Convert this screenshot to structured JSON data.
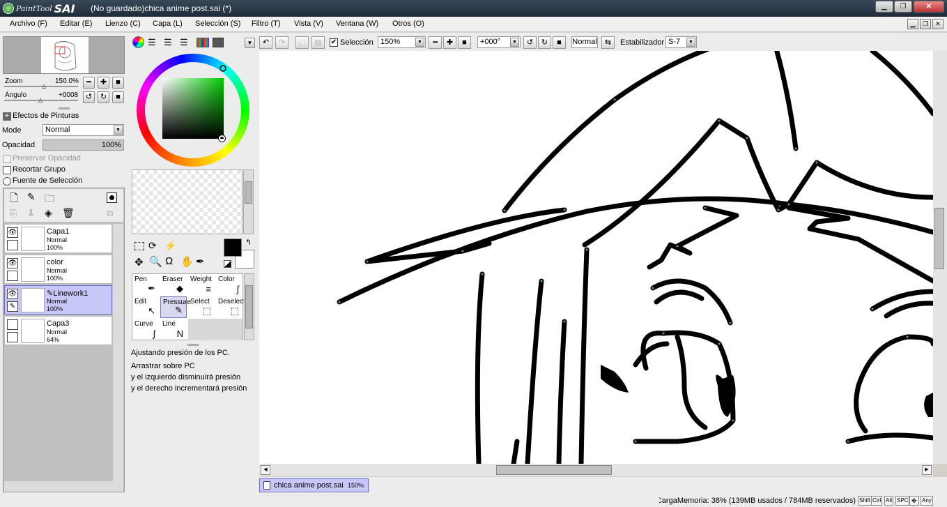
{
  "window": {
    "logo_text": "PaintTool",
    "logo_sai": "SAI",
    "title": "(No guardado)chica anime post.sai (*)"
  },
  "menu": [
    "Archivo (F)",
    "Editar (E)",
    "Lienzo (C)",
    "Capa (L)",
    "Selección (S)",
    "Filtro (T)",
    "Vista (V)",
    "Ventana (W)",
    "Otros (O)"
  ],
  "navigator": {
    "zoom_label": "Zoom",
    "zoom_value": "150.0%",
    "angle_label": "Ángulo",
    "angle_value": "+0008"
  },
  "layer_panel": {
    "effects_label": "Efectos de Pinturas",
    "mode_label": "Mode",
    "mode_value": "Normal",
    "opacity_label": "Opacidad",
    "opacity_value": "100%",
    "preserve_opacity": "Preservar Opacidad",
    "clip_group": "Recortar Grupo",
    "selection_source": "Fuente de Selección",
    "layers": [
      {
        "name": "Capa1",
        "mode": "Normal",
        "opacity": "100%",
        "visible": true,
        "selected": false
      },
      {
        "name": "color",
        "mode": "Normal",
        "opacity": "100%",
        "visible": true,
        "selected": false
      },
      {
        "name": "Linework1",
        "mode": "Normal",
        "opacity": "100%",
        "visible": true,
        "selected": true
      },
      {
        "name": "Capa3",
        "mode": "Normal",
        "opacity": "64%",
        "visible": false,
        "selected": false
      }
    ]
  },
  "tools": {
    "list": [
      "Pen",
      "Eraser",
      "Weight",
      "Color",
      "Edit",
      "Pressure",
      "Select",
      "Deselect",
      "Curve",
      "Line"
    ],
    "active": "Pressure",
    "primary_color": "#000000",
    "secondary_color": "#ffffff"
  },
  "help_text": {
    "line1": "Ajustando presión de los PC.",
    "line2": "Arrastrar sobre PC",
    "line3": "y el izquierdo disminuirá presión",
    "line4": "y el derecho incrementará presión"
  },
  "canvas_toolbar": {
    "selection_label": "Selección",
    "zoom_value": "150%",
    "angle_value": "+000°",
    "blend_value": "Normal",
    "stabilizer_label": "Estabilizador",
    "stabilizer_value": "S-7"
  },
  "canvas_tab": {
    "name": "chica anime post.sai",
    "zoom": "150%"
  },
  "status": {
    "memory_text": "CargaMemoria: 38% (139MB usados / 784MB reservados)",
    "keys": [
      "Shift",
      "Ctrl",
      "Alt",
      "SPC",
      "✥",
      "Any"
    ]
  },
  "colors": {
    "accent_selected": "#c8c8f8",
    "title_bar": "#1e2a38",
    "vector_node": "#4caf50"
  }
}
